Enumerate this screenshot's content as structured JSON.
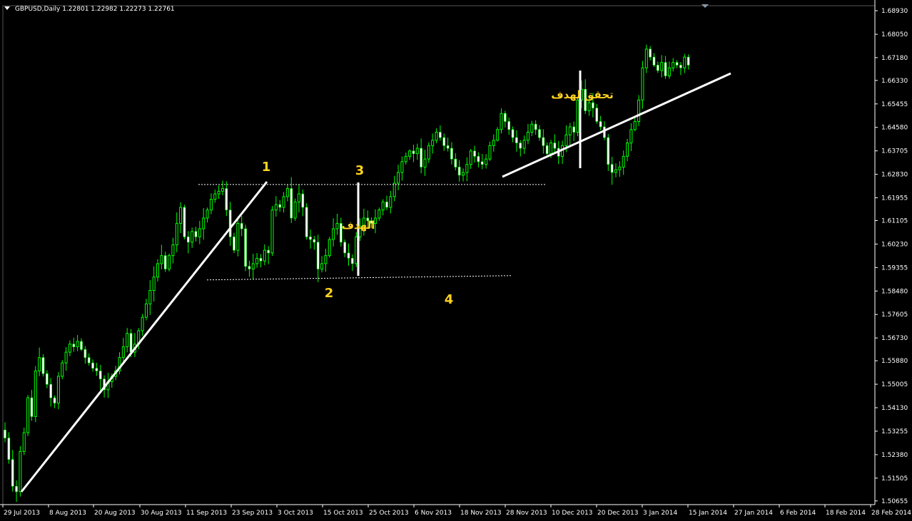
{
  "header": {
    "symbol": "GBPUSD,Daily",
    "ohlc": "1.22801 1.22982 1.22273 1.22761"
  },
  "colors": {
    "background": "#000000",
    "bull": "#00ff00",
    "bear_body": "#ffffff",
    "wick": "#00ff00",
    "trendline": "#ffffff",
    "annotation": "#ffd21f",
    "axis": "#ffffff"
  },
  "chart_data": {
    "type": "candlestick",
    "title": "",
    "ylim": [
      1.5065,
      1.6893
    ],
    "grid": false,
    "y_ticks": [
      "1.68930",
      "1.68050",
      "1.67180",
      "1.66330",
      "1.65455",
      "1.64580",
      "1.63705",
      "1.62830",
      "1.61955",
      "1.61105",
      "1.60230",
      "1.59355",
      "1.58480",
      "1.57605",
      "1.56730",
      "1.55880",
      "1.55005",
      "1.54130",
      "1.53255",
      "1.52380",
      "1.51505",
      "1.50655"
    ],
    "x_ticks": [
      "29 Jul 2013",
      "8 Aug 2013",
      "20 Aug 2013",
      "30 Aug 2013",
      "11 Sep 2013",
      "23 Sep 2013",
      "3 Oct 2013",
      "15 Oct 2013",
      "25 Oct 2013",
      "6 Nov 2013",
      "18 Nov 2013",
      "28 Nov 2013",
      "10 Dec 2013",
      "20 Dec 2013",
      "3 Jan 2014",
      "15 Jan 2014",
      "27 Jan 2014",
      "6 Feb 2014",
      "18 Feb 2014",
      "28 Feb 2014"
    ],
    "close": [
      1.53,
      1.522,
      1.512,
      1.51,
      1.525,
      1.532,
      1.545,
      1.538,
      1.555,
      1.56,
      1.554,
      1.55,
      1.545,
      1.543,
      1.553,
      1.558,
      1.562,
      1.565,
      1.564,
      1.566,
      1.563,
      1.56,
      1.558,
      1.556,
      1.555,
      1.552,
      1.548,
      1.551,
      1.553,
      1.555,
      1.56,
      1.564,
      1.569,
      1.562,
      1.565,
      1.57,
      1.575,
      1.58,
      1.585,
      1.59,
      1.595,
      1.598,
      1.593,
      1.598,
      1.602,
      1.61,
      1.616,
      1.605,
      1.603,
      1.607,
      1.605,
      1.608,
      1.612,
      1.615,
      1.619,
      1.621,
      1.622,
      1.623,
      1.615,
      1.605,
      1.6,
      1.61,
      1.608,
      1.594,
      1.593,
      1.595,
      1.597,
      1.596,
      1.6,
      1.599,
      1.615,
      1.617,
      1.616,
      1.62,
      1.623,
      1.612,
      1.618,
      1.621,
      1.616,
      1.605,
      1.604,
      1.603,
      1.593,
      1.595,
      1.598,
      1.604,
      1.608,
      1.61,
      1.603,
      1.599,
      1.597,
      1.595,
      1.605,
      1.609,
      1.612,
      1.611,
      1.61,
      1.612,
      1.615,
      1.618,
      1.616,
      1.62,
      1.625,
      1.629,
      1.633,
      1.635,
      1.637,
      1.636,
      1.638,
      1.631,
      1.634,
      1.639,
      1.641,
      1.644,
      1.642,
      1.639,
      1.638,
      1.634,
      1.631,
      1.628,
      1.629,
      1.632,
      1.637,
      1.635,
      1.633,
      1.632,
      1.634,
      1.639,
      1.641,
      1.645,
      1.651,
      1.648,
      1.645,
      1.642,
      1.64,
      1.638,
      1.641,
      1.644,
      1.647,
      1.645,
      1.642,
      1.639,
      1.636,
      1.64,
      1.638,
      1.635,
      1.639,
      1.643,
      1.646,
      1.644,
      1.656,
      1.66,
      1.652,
      1.655,
      1.653,
      1.648,
      1.646,
      1.642,
      1.632,
      1.629,
      1.63,
      1.631,
      1.635,
      1.64,
      1.645,
      1.648,
      1.656,
      1.668,
      1.675,
      1.672,
      1.669,
      1.667,
      1.67,
      1.665,
      1.668,
      1.67,
      1.669,
      1.668,
      1.672,
      1.669
    ],
    "trendlines": [
      {
        "from": [
          "29 Jul 2013",
          1.5085
        ],
        "to": [
          "23 Sep 2013",
          1.6245
        ]
      },
      {
        "from": [
          "28 Nov 2013",
          1.6275
        ],
        "to": [
          "27 Jan 2014",
          1.668
        ]
      }
    ],
    "levels": [
      {
        "name": "resistance",
        "value": 1.6245,
        "style": "dotted"
      },
      {
        "name": "support",
        "value": 1.59,
        "style": "dotted"
      }
    ],
    "annotations": [
      "1",
      "2",
      "3",
      "4",
      "الهدف",
      "تحقق لهدف"
    ]
  }
}
